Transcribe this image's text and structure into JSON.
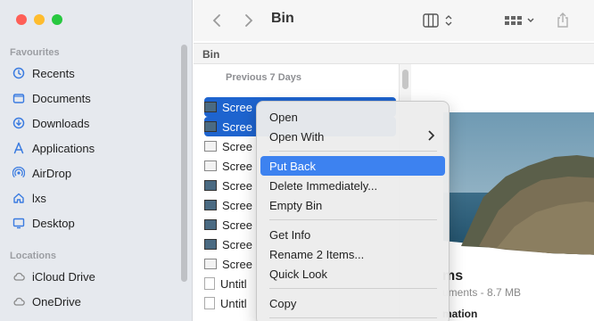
{
  "window": {
    "title": "Bin",
    "path": "Bin"
  },
  "sidebar": {
    "sections": [
      {
        "title": "Favourites"
      },
      {
        "title": "Locations"
      }
    ],
    "favourites": [
      {
        "label": "Recents",
        "icon": "clock-icon"
      },
      {
        "label": "Documents",
        "icon": "document-icon"
      },
      {
        "label": "Downloads",
        "icon": "download-icon"
      },
      {
        "label": "Applications",
        "icon": "applications-icon"
      },
      {
        "label": "AirDrop",
        "icon": "airdrop-icon"
      },
      {
        "label": "lxs",
        "icon": "home-icon"
      },
      {
        "label": "Desktop",
        "icon": "desktop-icon"
      }
    ],
    "locations": [
      {
        "label": "iCloud Drive",
        "icon": "cloud-icon"
      },
      {
        "label": "OneDrive",
        "icon": "cloud-icon"
      }
    ]
  },
  "list": {
    "group": "Previous 7 Days",
    "rows": [
      {
        "name": "Scree",
        "selected": true
      },
      {
        "name": "Scree",
        "selected": true
      },
      {
        "name": "Scree",
        "selected": false
      },
      {
        "name": "Scree",
        "selected": false
      },
      {
        "name": "Scree",
        "selected": false
      },
      {
        "name": "Scree",
        "selected": false
      },
      {
        "name": "Scree",
        "selected": false
      },
      {
        "name": "Scree",
        "selected": false
      },
      {
        "name": "Scree",
        "selected": false
      },
      {
        "name": "Untitl",
        "selected": false
      },
      {
        "name": "Untitl",
        "selected": false
      }
    ]
  },
  "preview": {
    "title": "ms",
    "subtitle": "uments - 8.7 MB",
    "info": "mation"
  },
  "context_menu": {
    "items": [
      {
        "label": "Open",
        "highlighted": false
      },
      {
        "label": "Open With",
        "highlighted": false,
        "submenu": true
      },
      {
        "label": "Put Back",
        "highlighted": true
      },
      {
        "label": "Delete Immediately...",
        "highlighted": false
      },
      {
        "label": "Empty Bin",
        "highlighted": false
      },
      {
        "label": "Get Info",
        "highlighted": false
      },
      {
        "label": "Rename 2 Items...",
        "highlighted": false
      },
      {
        "label": "Quick Look",
        "highlighted": false
      },
      {
        "label": "Copy",
        "highlighted": false
      }
    ]
  },
  "colors": {
    "selection": "#1e64cf",
    "menu_highlight": "#3d82f0",
    "sidebar_icon": "#3a7be0"
  }
}
